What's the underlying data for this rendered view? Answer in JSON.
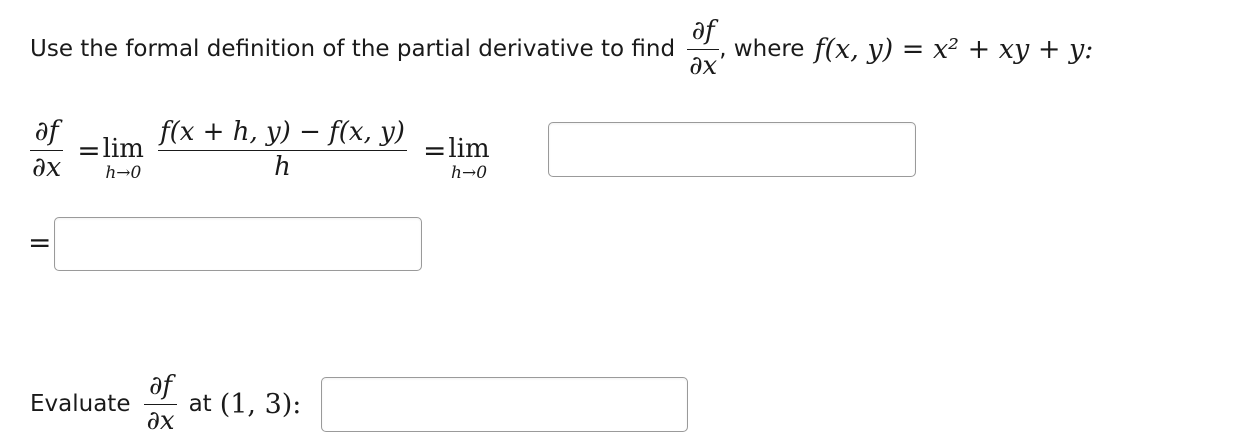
{
  "prompt": {
    "text_before": "Use the formal definition of the partial derivative to find",
    "frac_num": "∂f",
    "frac_den": "∂x",
    "text_after": ", where",
    "function_def": "f(x, y) = x² + xy + y:"
  },
  "definition": {
    "lhs_num": "∂f",
    "lhs_den": "∂x",
    "equals": "=",
    "lim_word": "lim",
    "lim_sub": "h→0",
    "quot_num": "f(x + h, y) − f(x, y)",
    "quot_den": "h",
    "equals2": "=",
    "lim2_word": "lim",
    "lim2_sub": "h→0",
    "input1_value": ""
  },
  "step2": {
    "equals": "=",
    "input2_value": ""
  },
  "evaluate": {
    "label": "Evaluate",
    "frac_num": "∂f",
    "frac_den": "∂x",
    "at_text": "at",
    "point": "(1, 3):",
    "input3_value": ""
  }
}
